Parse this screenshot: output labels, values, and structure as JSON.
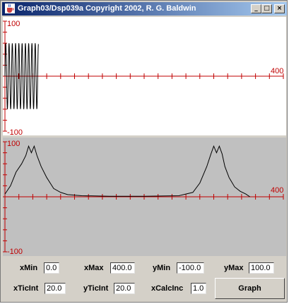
{
  "window": {
    "title": "Graph03/Dsp039a Copyright 2002, R. G. Baldwin",
    "minimize_glyph": "_",
    "maximize_glyph": "□",
    "close_glyph": "×",
    "icon": "java-cup-icon"
  },
  "plots": [
    {
      "y_max_label": "100",
      "y_min_label": "-100",
      "x_max_label": "400",
      "background": "#ffffff"
    },
    {
      "y_max_label": "100",
      "y_min_label": "-100",
      "x_max_label": "400",
      "background": "#c0c0c0"
    }
  ],
  "colors": {
    "axis": "#c00000",
    "curve": "#000000",
    "title_bar_start": "#0a246a",
    "title_bar_end": "#a6caf0"
  },
  "chart_data": [
    {
      "type": "line",
      "xlim": [
        0,
        400
      ],
      "ylim": [
        -100,
        100
      ],
      "x_tick_interval": 20,
      "y_tick_interval": 20,
      "series": [
        {
          "description_only": false,
          "x_start": 0,
          "x_end": 48,
          "amplitude": 60,
          "period": 4.7
        }
      ]
    },
    {
      "type": "line",
      "xlim": [
        0,
        400
      ],
      "ylim": [
        -100,
        100
      ],
      "x_tick_interval": 20,
      "y_tick_interval": 20,
      "series": [
        {
          "x": [
            0,
            8,
            16,
            24,
            30,
            34,
            38,
            42,
            46,
            52,
            60,
            70,
            80,
            90,
            110,
            150,
            200,
            250,
            270,
            280,
            290,
            296,
            300,
            304,
            308,
            312,
            316,
            322,
            330,
            338,
            346,
            352
          ],
          "y": [
            5,
            20,
            45,
            60,
            75,
            92,
            80,
            92,
            75,
            55,
            35,
            15,
            8,
            4,
            2,
            1,
            1,
            2,
            8,
            25,
            55,
            78,
            92,
            80,
            92,
            78,
            55,
            35,
            18,
            10,
            5,
            0
          ]
        }
      ]
    }
  ],
  "controls": {
    "xmin_label": "xMin",
    "xmin_value": "0.0",
    "xmax_label": "xMax",
    "xmax_value": "400.0",
    "ymin_label": "yMin",
    "ymin_value": "-100.0",
    "ymax_label": "yMax",
    "ymax_value": "100.0",
    "xticint_label": "xTicInt",
    "xticint_value": "20.0",
    "yticint_label": "yTicInt",
    "yticint_value": "20.0",
    "xcalcinc_label": "xCalcInc",
    "xcalcinc_value": "1.0",
    "graph_button": "Graph"
  }
}
